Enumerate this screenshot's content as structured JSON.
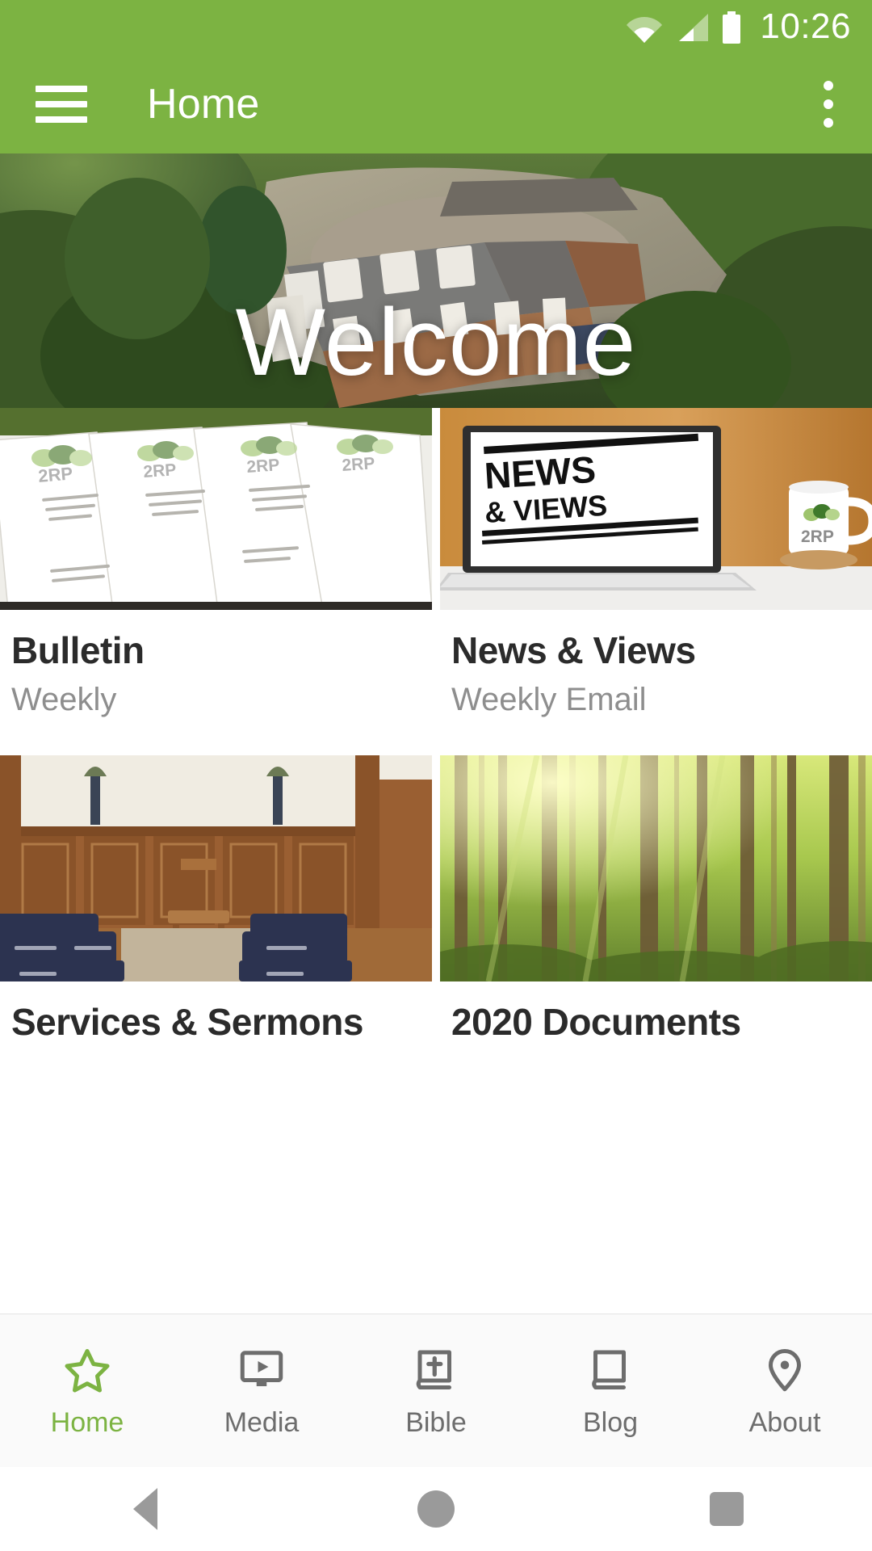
{
  "status_bar": {
    "time": "10:26",
    "icons": [
      "wifi-icon",
      "cellular-signal-icon",
      "battery-icon"
    ]
  },
  "app_bar": {
    "title": "Home",
    "menu_icon": "hamburger-menu-icon",
    "overflow_icon": "overflow-menu-icon",
    "background_color": "#7cb342"
  },
  "hero": {
    "title": "Welcome",
    "image_alt": "aerial-view-of-church-building-surrounded-by-trees"
  },
  "tiles": [
    {
      "title": "Bulletin",
      "subtitle": "Weekly",
      "image_alt": "stack-of-printed-church-bulletins-2rp-logo"
    },
    {
      "title": "News & Views",
      "subtitle": "Weekly Email",
      "image_alt": "laptop-showing-news-and-views-header-with-2rp-mug"
    },
    {
      "title": "Services & Sermons",
      "subtitle": "",
      "image_alt": "church-sanctuary-with-wooden-pulpit-and-blue-chairs"
    },
    {
      "title": "2020 Documents",
      "subtitle": "",
      "image_alt": "sunlit-forest-with-tall-trees"
    }
  ],
  "bottom_nav": {
    "active_index": 0,
    "active_color": "#7cb342",
    "inactive_color": "#6d6d6d",
    "items": [
      {
        "label": "Home",
        "icon": "star-icon"
      },
      {
        "label": "Media",
        "icon": "monitor-play-icon"
      },
      {
        "label": "Bible",
        "icon": "book-cross-icon"
      },
      {
        "label": "Blog",
        "icon": "book-icon"
      },
      {
        "label": "About",
        "icon": "location-pin-icon"
      }
    ]
  },
  "system_nav": {
    "items": [
      {
        "name": "back-button",
        "icon": "triangle-back-icon"
      },
      {
        "name": "home-button",
        "icon": "circle-home-icon"
      },
      {
        "name": "recents-button",
        "icon": "square-recents-icon"
      }
    ]
  }
}
